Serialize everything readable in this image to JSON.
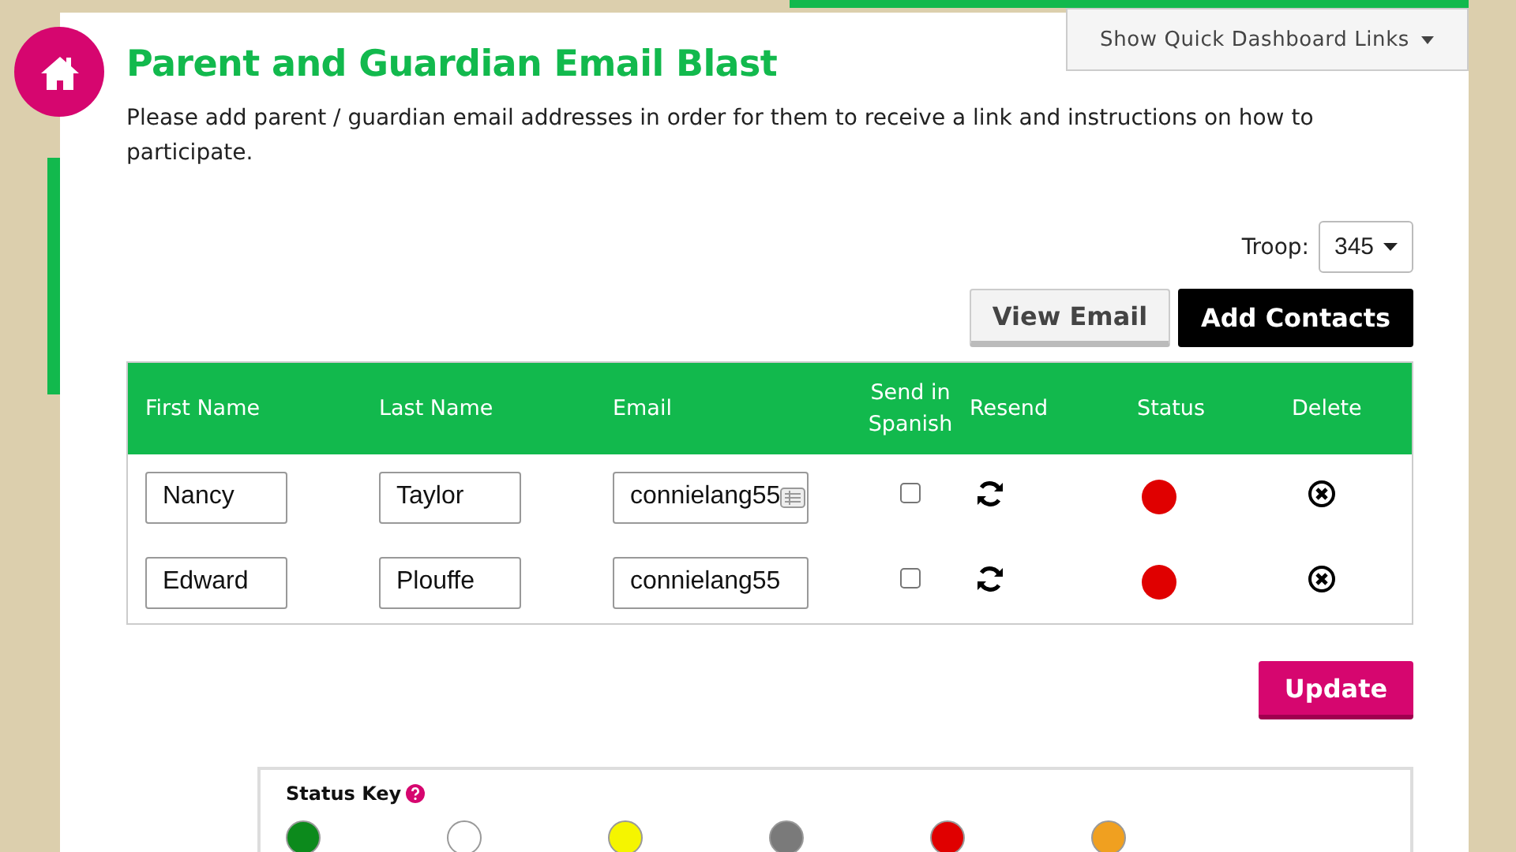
{
  "header": {
    "title": "Parent and Guardian Email Blast",
    "quick_links_button": "Show Quick Dashboard Links",
    "description": "Please add parent / guardian email addresses in order for them to receive a link and instructions on how to participate."
  },
  "troop": {
    "label": "Troop:",
    "value": "345"
  },
  "actions": [
    "View Email",
    "Add Contacts"
  ],
  "table": {
    "columns": [
      "First Name",
      "Last Name",
      "Email",
      "Send in Spanish",
      "Resend",
      "Status",
      "Delete"
    ],
    "rows": [
      {
        "first_name": "Nancy",
        "last_name": "Taylor",
        "email": "connielang55",
        "send_in_spanish": false,
        "color": "#e00000"
      },
      {
        "first_name": "Edward",
        "last_name": "Plouffe",
        "email": "connielang55",
        "send_in_spanish": false,
        "color": "#e00000"
      }
    ]
  },
  "update_button": "Update",
  "status_key": {
    "title": "Status Key",
    "items": [
      {
        "color": "#0c8a1c"
      },
      {
        "color": "#ffffff"
      },
      {
        "color": "#f5f500"
      },
      {
        "color": "#7a7a7a"
      },
      {
        "color": "#e00000"
      },
      {
        "color": "#f0a020"
      }
    ]
  }
}
